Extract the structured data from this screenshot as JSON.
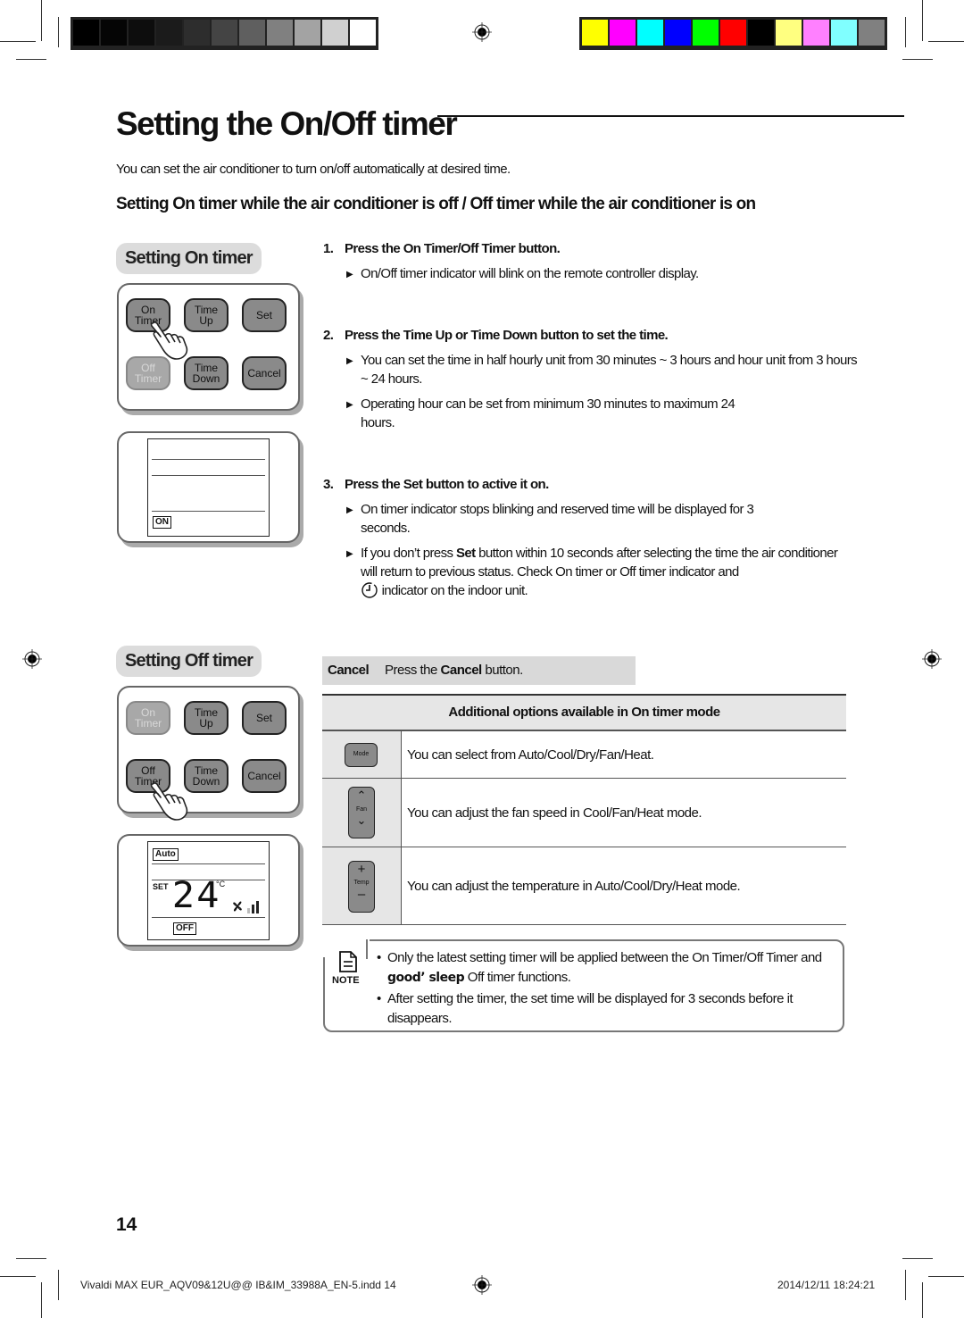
{
  "color_bars": {
    "grayscale": [
      "#000000",
      "#050505",
      "#0d0d0d",
      "#1b1b1b",
      "#2d2d2d",
      "#444444",
      "#5f5f5f",
      "#808080",
      "#a3a3a3",
      "#d0d0d0",
      "#ffffff"
    ],
    "process": [
      "#ffff00",
      "#ff00ff",
      "#00ffff",
      "#0000ff",
      "#00ff00",
      "#ff0000",
      "#000000",
      "#ffff80",
      "#ff80ff",
      "#80ffff",
      "#808080"
    ]
  },
  "page": {
    "title": "Setting the On/Off timer",
    "intro": "You can set the air conditioner to turn on/off automatically at desired time.",
    "subheading": "Setting On timer while the air conditioner is off / Off timer while the air conditioner is on"
  },
  "on_timer_section": {
    "label": "Setting On timer",
    "buttons": [
      {
        "l1": "On",
        "l2": "Timer",
        "state": "pressed"
      },
      {
        "l1": "Time",
        "l2": "Up",
        "state": "normal"
      },
      {
        "l1": "Set",
        "l2": "",
        "state": "normal"
      },
      {
        "l1": "Off",
        "l2": "Timer",
        "state": "disabled"
      },
      {
        "l1": "Time",
        "l2": "Down",
        "state": "normal"
      },
      {
        "l1": "Cancel",
        "l2": "",
        "state": "normal"
      }
    ],
    "display_indicator": "ON"
  },
  "off_timer_section": {
    "label": "Setting Off timer",
    "buttons": [
      {
        "l1": "On",
        "l2": "Timer",
        "state": "disabled"
      },
      {
        "l1": "Time",
        "l2": "Up",
        "state": "normal"
      },
      {
        "l1": "Set",
        "l2": "",
        "state": "normal"
      },
      {
        "l1": "Off",
        "l2": "Timer",
        "state": "pressed"
      },
      {
        "l1": "Time",
        "l2": "Down",
        "state": "normal"
      },
      {
        "l1": "Cancel",
        "l2": "",
        "state": "normal"
      }
    ],
    "display": {
      "mode": "Auto",
      "set_label": "SET",
      "temperature": "24",
      "unit": "°C",
      "indicator": "OFF"
    }
  },
  "steps": [
    {
      "num": "1.",
      "pre": "Press the ",
      "bold": "On Timer/Off Timer",
      "mid": "",
      "bold2": "",
      "post": " button.",
      "bullets": [
        "On/Off timer indicator will blink on the remote controller display."
      ]
    },
    {
      "num": "2.",
      "pre": "Press the ",
      "bold": "Time Up",
      "mid": " or ",
      "bold2": "Time Down",
      "post": " button to set the time.",
      "bullets": [
        "You can set the time in half hourly unit from 30 minutes ~ 3 hours and hour unit from 3 hours ~ 24 hours.",
        "Operating hour can be set from minimum 30 minutes to maximum 24 hours."
      ]
    },
    {
      "num": "3.",
      "pre": "Press the ",
      "bold": "Set",
      "mid": "",
      "bold2": "",
      "post": " button to active it on.",
      "bullets": [
        "On timer indicator stops blinking and reserved time will be displayed for 3 seconds."
      ],
      "bullet_rich": {
        "pre": "If you don’t press ",
        "bold": "Set",
        "post": " button within 10 seconds after selecting the time the air conditioner will return to previous status. Check On timer or Off timer indicator and",
        "tail": " indicator on the indoor unit."
      }
    }
  ],
  "cancel": {
    "label": "Cancel",
    "pre": "Press the ",
    "bold": "Cancel",
    "post": " button."
  },
  "options_table": {
    "header": "Additional options available in On timer mode",
    "rows": [
      {
        "icon": "mode-button-icon",
        "icon_label": "Mode",
        "text": "You can select from Auto/Cool/Dry/Fan/Heat."
      },
      {
        "icon": "fan-button-icon",
        "icon_label": "Fan",
        "text": "You can adjust the fan speed in Cool/Fan/Heat mode."
      },
      {
        "icon": "temp-button-icon",
        "icon_label": "Temp",
        "text": "You can adjust the temperature in Auto/Cool/Dry/Heat mode."
      }
    ]
  },
  "note": {
    "label": "NOTE",
    "item1_pre": "Only the latest setting timer will be applied between the On Timer/Off Timer and ",
    "item1_bold": "good’ sleep",
    "item1_post": " Off timer functions.",
    "item2": "After setting the timer, the set time will be displayed for 3 seconds before it disappears."
  },
  "footer": {
    "page_number": "14",
    "slug_file": "Vivaldi MAX EUR_AQV09&12U@@ IB&IM_33988A_EN-5.indd   14",
    "slug_date": "2014/12/11   18:24:21"
  }
}
